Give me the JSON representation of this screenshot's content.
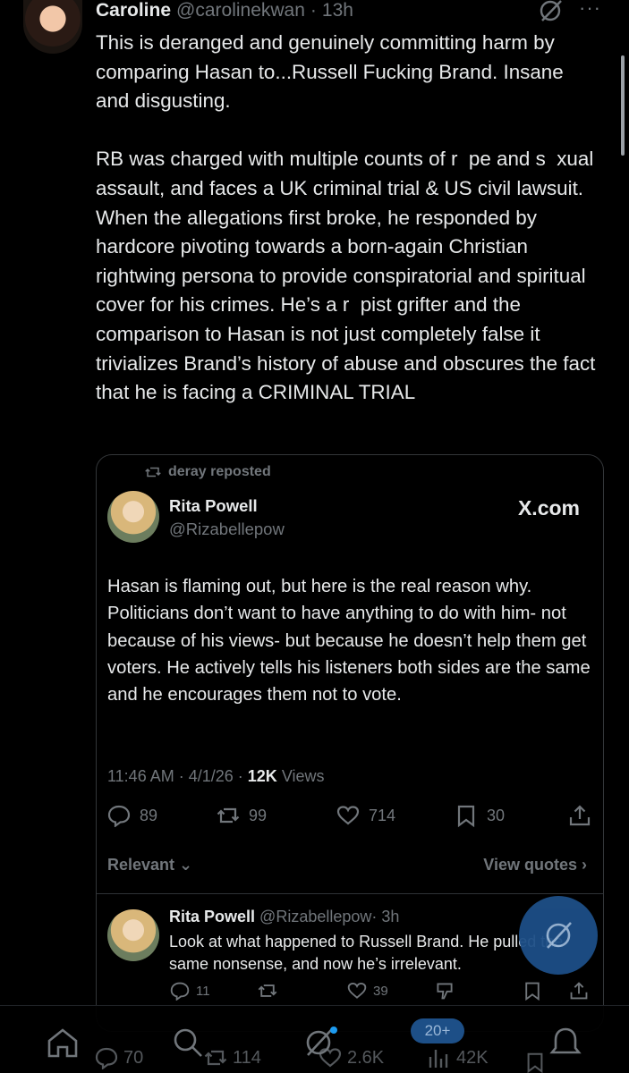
{
  "post": {
    "author_name": "Caroline",
    "author_handle": "@carolinekwan",
    "separator": "·",
    "time": "13h",
    "more": "···",
    "text": "This is deranged and genuinely committing harm by comparing Hasan to...Russell Fucking Brand. Insane and disgusting.\n\nRB was charged with multiple counts of r  pe and s  xual assault, and faces a UK criminal trial & US civil lawsuit. When the allegations first broke, he responded by hardcore pivoting towards a born-again Christian rightwing persona to provide conspiratorial and spiritual cover for his crimes. He’s a r  pist grifter and the comparison to Hasan is not just completely false it trivializes Brand’s history of abuse and obscures the fact that he is facing a CRIMINAL TRIAL"
  },
  "quote": {
    "repost_label": "deray reposted",
    "author_name": "Rita Powell",
    "author_handle": "@Rizabellepow",
    "source": "X.com",
    "text": "Hasan is flaming out, but here is the real reason why. Politicians don’t want to have anything to do with him- not because of his views- but because he doesn’t help them get voters. He actively tells his listeners both sides are the same and he encourages them not to vote.",
    "time": "11:46 AM",
    "date": "4/1/26",
    "views_count": "12K",
    "views_label": "Views",
    "replies": "89",
    "reposts": "99",
    "likes": "714",
    "bookmarks": "30",
    "filter_label": "Relevant ⌄",
    "view_quotes_label": "View quotes ›"
  },
  "reply": {
    "author_name": "Rita Powell",
    "author_handle": "@Rizabellepow",
    "time": "· 3h",
    "more": "···",
    "text": "Look at what happened to Russell Brand. He pulled the same nonsense, and now he’s irrelevant.",
    "replies": "11",
    "likes": "39"
  },
  "bottom_bar": {
    "replies": "70",
    "reposts": "114",
    "likes": "2.6K",
    "views": "42K",
    "new_posts_badge": "20+"
  },
  "colors": {
    "background": "#000000",
    "text": "#e7e9ea",
    "muted": "#71767b",
    "accent": "#1d9bf0",
    "fab": "#1d4f87"
  },
  "icons": [
    "grok-icon",
    "more-icon",
    "repost-icon",
    "reply-icon",
    "like-icon",
    "bookmark-icon",
    "share-icon",
    "downvote-icon",
    "home-icon",
    "search-icon",
    "bell-icon",
    "mail-icon",
    "views-icon"
  ]
}
